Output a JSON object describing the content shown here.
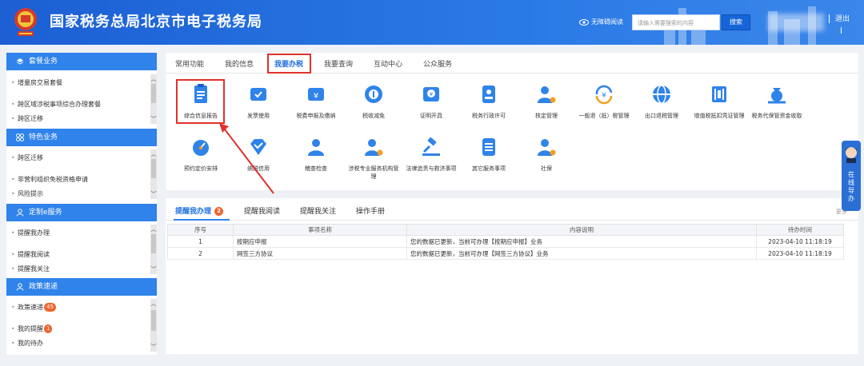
{
  "header": {
    "title": "国家税务总局北京市电子税务局",
    "accessibility": "无障碍阅读",
    "search_placeholder": "请输入需要搜索的内容",
    "search_button": "搜索",
    "logout": "退出"
  },
  "sidebar": {
    "sections": [
      {
        "title": "套餐业务",
        "items": [
          "增量房交易套餐",
          "跨区域涉税事项综合办理套餐",
          "跨区迁移"
        ]
      },
      {
        "title": "特色业务",
        "items": [
          "跨区迁移",
          "非营利组织免税资格申请",
          "风险提示"
        ]
      },
      {
        "title": "定制e服务",
        "items": [
          "提醒我办理",
          "提醒我阅读",
          "提醒我关注"
        ]
      },
      {
        "title": "政策速递",
        "items": [
          "政策速递",
          "我的提醒",
          "我的待办"
        ],
        "badges": [
          "45",
          "1"
        ]
      }
    ]
  },
  "tabs": [
    "常用功能",
    "我的信息",
    "我要办税",
    "我要查询",
    "互动中心",
    "公众服务"
  ],
  "services": [
    "综合信息报告",
    "发票使用",
    "税费申报及缴纳",
    "税收减免",
    "证明开具",
    "税务行政许可",
    "核定管理",
    "一般退（抵）税管理",
    "出口退税管理",
    "增值税抵扣凭证管理",
    "税务代保管资金收取",
    "预约定价安排",
    "纳税信用",
    "稽查检查",
    "涉税专业服务机构管理",
    "法律追责与救济事项",
    "其它服务事项",
    "社保"
  ],
  "reminders": {
    "tabs": [
      "提醒我办理",
      "提醒我阅读",
      "提醒我关注",
      "操作手册"
    ],
    "badge": "2",
    "more": "更多",
    "columns": [
      "序号",
      "事项名称",
      "内容说明",
      "待办时间"
    ],
    "rows": [
      {
        "no": "1",
        "name": "按期应申报",
        "desc": "您的数据已更新，当前可办理【按期应申报】业务",
        "time": "2023-04-10 11:18:19"
      },
      {
        "no": "2",
        "name": "网签三方协议",
        "desc": "您的数据已更新，当前可办理【网签三方协议】业务",
        "time": "2023-04-10 11:18:19"
      }
    ]
  },
  "float_help": "在线导办",
  "colors": {
    "primary": "#2f83ea",
    "header": "#1c5fd3",
    "highlight": "#e0322b",
    "badge": "#f0652e"
  }
}
